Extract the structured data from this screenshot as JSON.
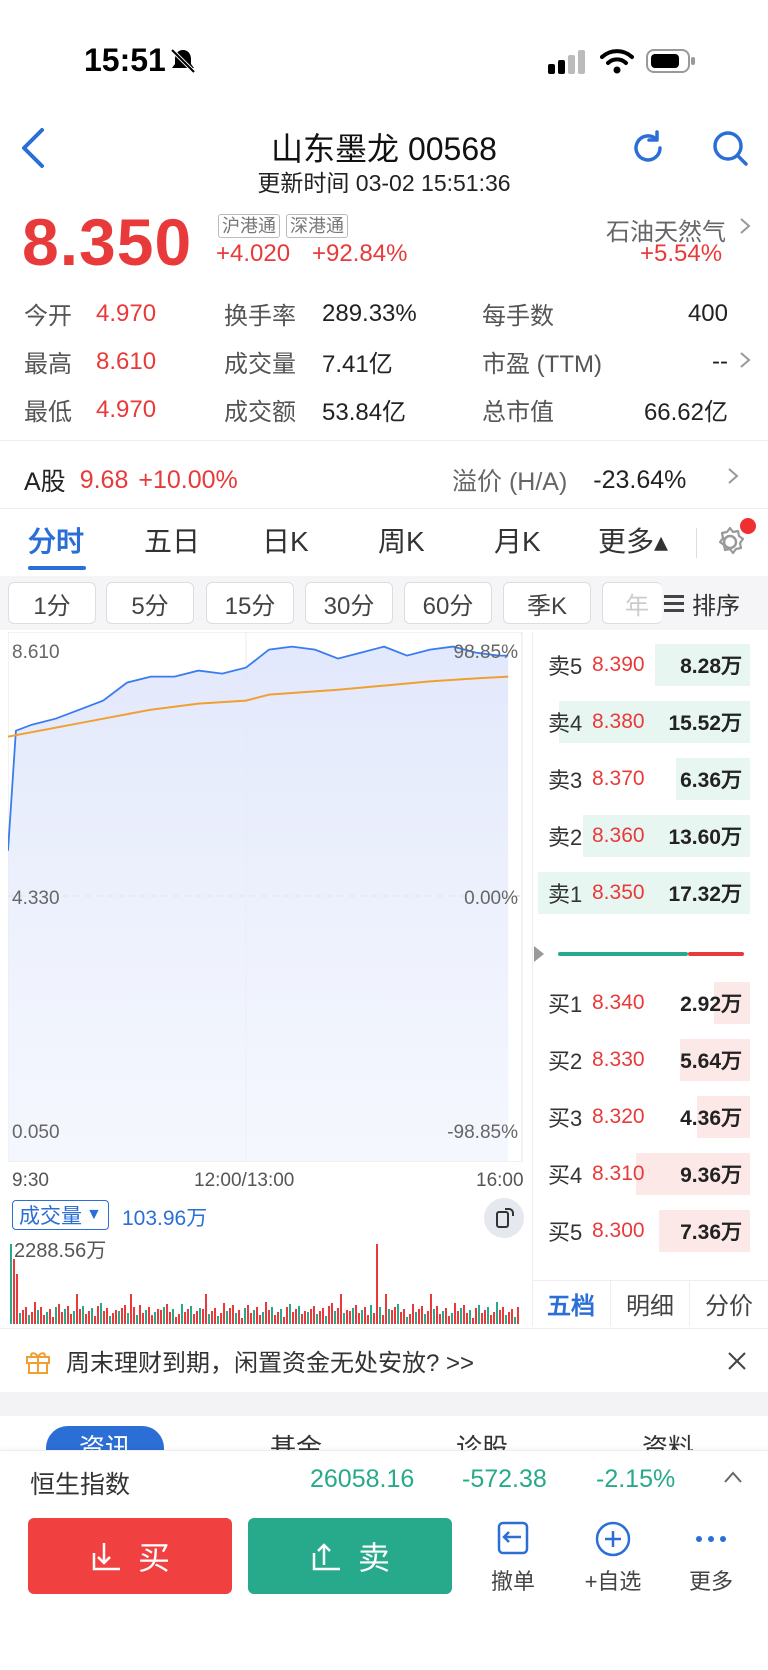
{
  "status": {
    "time": "15:51"
  },
  "header": {
    "title": "山东墨龙 00568",
    "subtitle": "更新时间 03-02 15:51:36"
  },
  "quote": {
    "price": "8.350",
    "badges": [
      "沪港通",
      "深港通"
    ],
    "change": "+4.020",
    "change_pct": "+92.84%",
    "sector_name": "石油天然气",
    "sector_change": "+5.54%"
  },
  "stats": [
    {
      "label": "今开",
      "value": "4.970"
    },
    {
      "label": "换手率",
      "value": "289.33%"
    },
    {
      "label": "每手数",
      "value": "400"
    },
    {
      "label": "最高",
      "value": "8.610"
    },
    {
      "label": "成交量",
      "value": "7.41亿"
    },
    {
      "label": "市盈 (TTM)",
      "value": "--"
    },
    {
      "label": "最低",
      "value": "4.970"
    },
    {
      "label": "成交额",
      "value": "53.84亿"
    },
    {
      "label": "总市值",
      "value": "66.62亿"
    }
  ],
  "a_share": {
    "label": "A股",
    "price": "9.68",
    "change_pct": "+10.00%",
    "premium_label": "溢价 (H/A)",
    "premium_value": "-23.64%"
  },
  "tabs": [
    "分时",
    "五日",
    "日K",
    "周K",
    "月K",
    "更多▴"
  ],
  "intervals": [
    "1分",
    "5分",
    "15分",
    "30分",
    "60分",
    "季K",
    "年"
  ],
  "sort_label": "排序",
  "chart_data": {
    "type": "line",
    "y_ticks_left": [
      "8.610",
      "4.330",
      "0.050"
    ],
    "y_ticks_right": [
      "98.85%",
      "0.00%",
      "-98.85%"
    ],
    "x_ticks": [
      "9:30",
      "12:00/13:00",
      "16:00"
    ],
    "ylim": [
      0.05,
      8.61
    ],
    "series": [
      {
        "x": [
          "9:30",
          "9:35",
          "9:45",
          "10:00",
          "10:15",
          "10:30",
          "10:45",
          "11:00",
          "11:15",
          "11:30",
          "11:45",
          "12:00",
          "13:15",
          "13:30",
          "13:45",
          "14:00",
          "14:15",
          "14:30",
          "14:45",
          "15:00",
          "15:15",
          "15:30",
          "15:45",
          "15:51"
        ],
        "values": [
          5.1,
          7.1,
          7.2,
          7.3,
          7.45,
          7.6,
          7.9,
          8.0,
          8.0,
          8.1,
          8.05,
          8.15,
          8.45,
          8.5,
          8.45,
          8.3,
          8.4,
          8.5,
          8.35,
          8.45,
          8.5,
          8.4,
          8.35,
          8.35
        ],
        "color": "#3a7bf0"
      },
      {
        "x": [
          "9:30",
          "10:00",
          "10:30",
          "11:00",
          "11:30",
          "12:00",
          "13:15",
          "14:00",
          "14:30",
          "15:00",
          "15:30",
          "15:51"
        ],
        "values": [
          7.0,
          7.15,
          7.3,
          7.45,
          7.55,
          7.6,
          7.7,
          7.78,
          7.85,
          7.92,
          7.97,
          8.0
        ],
        "color": "#f0a030"
      }
    ],
    "volume": {
      "label": "成交量",
      "current": "103.96万",
      "max_label": "2288.56万"
    }
  },
  "order_book": {
    "sell": [
      {
        "label": "卖5",
        "price": "8.390",
        "vol": "8.28万",
        "ratio": 0.45
      },
      {
        "label": "卖4",
        "price": "8.380",
        "vol": "15.52万",
        "ratio": 0.9
      },
      {
        "label": "卖3",
        "price": "8.370",
        "vol": "6.36万",
        "ratio": 0.35
      },
      {
        "label": "卖2",
        "price": "8.360",
        "vol": "13.60万",
        "ratio": 0.79
      },
      {
        "label": "卖1",
        "price": "8.350",
        "vol": "17.32万",
        "ratio": 1.0
      }
    ],
    "buy": [
      {
        "label": "买1",
        "price": "8.340",
        "vol": "2.92万",
        "ratio": 0.17
      },
      {
        "label": "买2",
        "price": "8.330",
        "vol": "5.64万",
        "ratio": 0.33
      },
      {
        "label": "买3",
        "price": "8.320",
        "vol": "4.36万",
        "ratio": 0.25
      },
      {
        "label": "买4",
        "price": "8.310",
        "vol": "9.36万",
        "ratio": 0.54
      },
      {
        "label": "买5",
        "price": "8.300",
        "vol": "7.36万",
        "ratio": 0.43
      }
    ],
    "tabs": [
      "五档",
      "明细",
      "分价"
    ]
  },
  "promo": {
    "text": "周末理财到期，闲置资金无处安放? >>"
  },
  "news_tabs_partial": [
    "资讯",
    "基金",
    "诊股",
    "资料"
  ],
  "index_bar": {
    "name": "恒生指数",
    "value": "26058.16",
    "change": "-572.38",
    "change_pct": "-2.15%"
  },
  "bottom": {
    "buy_label": "买",
    "sell_label": "卖",
    "cancel_label": "撤单",
    "watch_label": "+自选",
    "more_label": "更多"
  },
  "colors": {
    "up": "#e83a3a",
    "down": "#27a98b",
    "accent": "#2b6fd6"
  }
}
